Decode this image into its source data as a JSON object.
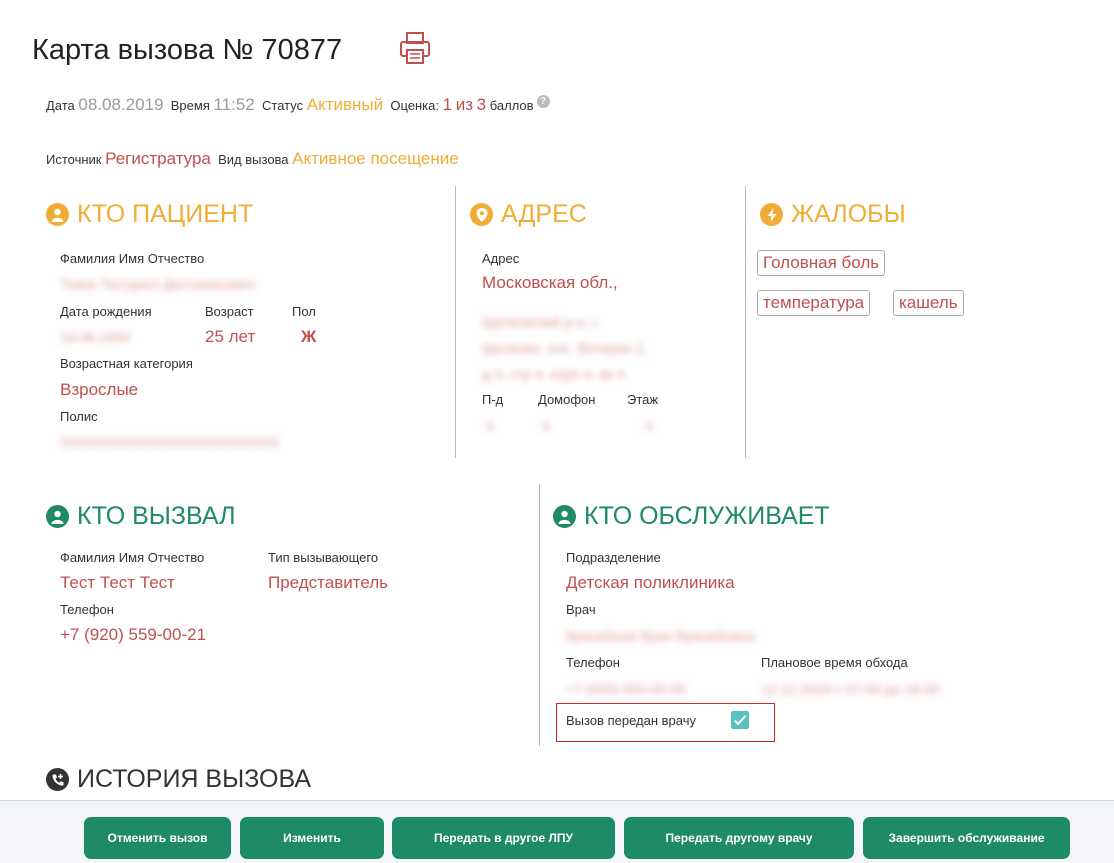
{
  "header": {
    "title": "Карта вызова № 70877",
    "date_label": "Дата",
    "date": "08.08.2019",
    "time_label": "Время",
    "time": "11:52",
    "status_label": "Статус",
    "status": "Активный",
    "rating_label": "Оценка:",
    "rating_score": "1",
    "rating_of": "из",
    "rating_max": "3",
    "rating_unit": "баллов",
    "source_label": "Источник",
    "source": "Регистратура",
    "call_type_label": "Вид вызова",
    "call_type": "Активное посещение"
  },
  "patient": {
    "heading": "КТО ПАЦИЕНТ",
    "fio_label": "Фамилия Имя Отчество",
    "fio": "Тевек Тестдисп Дестинисович",
    "birth_label": "Дата рождения",
    "birth": "14.06.1994",
    "age_label": "Возраст",
    "age": "25 лет",
    "sex_label": "Пол",
    "sex": "Ж",
    "age_cat_label": "Возрастная категория",
    "age_cat": "Взрослые",
    "policy_label": "Полис",
    "policy": "5555555555555555555555555"
  },
  "address": {
    "heading": "АДРЕС",
    "label": "Адрес",
    "line1": "Московская обл.,",
    "line2": "Щелковский р-н, г.",
    "line3": "Щелково, пос. Ветеран 2,",
    "line4": "д 3, стр 4, корп 4, кв 4",
    "entrance_label": "П-д",
    "entrance": "4",
    "intercom_label": "Домофон",
    "intercom": "4",
    "floor_label": "Этаж",
    "floor": "4"
  },
  "complaints": {
    "heading": "ЖАЛОБЫ",
    "tags": [
      "Головная боль",
      "температура",
      "кашель"
    ]
  },
  "caller": {
    "heading": "КТО ВЫЗВАЛ",
    "fio_label": "Фамилия Имя Отчество",
    "fio": "Тест Тест Тест",
    "type_label": "Тип вызывающего",
    "type": "Представитель",
    "phone_label": "Телефон",
    "phone": "+7 (920) 559-00-21"
  },
  "service": {
    "heading": "КТО ОБСЛУЖИВАЕТ",
    "dept_label": "Подразделение",
    "dept": "Детская поликлиника",
    "doctor_label": "Врач",
    "doctor": "Врачебная Врач Врачебовна",
    "phone_label": "Телефон",
    "phone": "+7 (000) 000-00-00",
    "planned_label": "Плановое время обхода",
    "planned": "12.12.2019 с 07:00 до 18:00",
    "transferred_label": "Вызов передан врачу",
    "transferred": true
  },
  "history": {
    "heading": "ИСТОРИЯ ВЫЗОВА"
  },
  "actions": {
    "cancel": "Отменить вызов",
    "edit": "Изменить",
    "transfer_lpu": "Передать в другое ЛПУ",
    "transfer_doctor": "Передать другому врачу",
    "finish": "Завершить обслуживание"
  },
  "colors": {
    "accent_orange": "#f0ad36",
    "value_red": "#c0504d",
    "green": "#1f8a66",
    "checkbox": "#5bc0c2"
  }
}
